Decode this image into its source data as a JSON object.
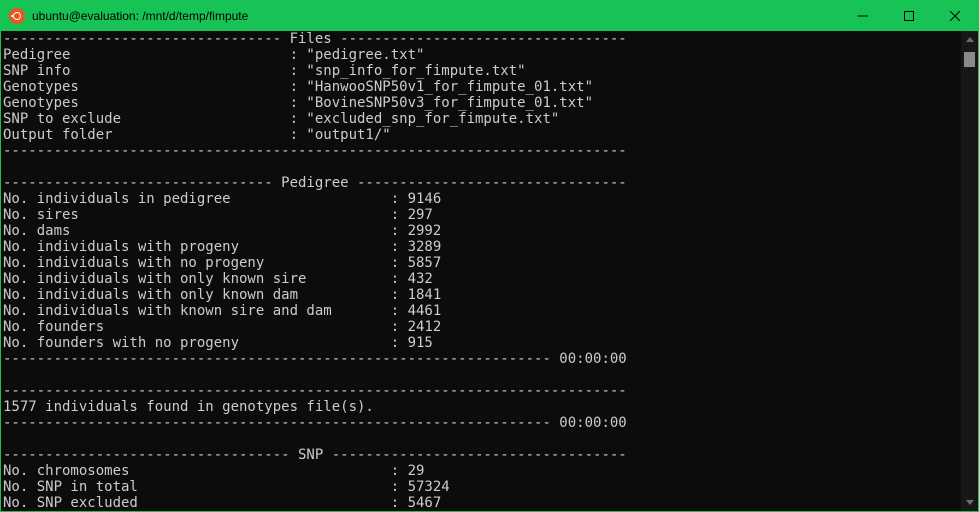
{
  "window": {
    "title": "ubuntu@evaluation: /mnt/d/temp/fimpute",
    "icon": "ubuntu-icon",
    "controls": [
      "minimize-icon",
      "maximize-icon",
      "close-icon"
    ]
  },
  "colors": {
    "titlebar": "#17c354",
    "terminal_bg": "#0c0c0c",
    "terminal_text": "#cccccc"
  },
  "terminal": {
    "lines": [
      "--------------------------------- Files ----------------------------------",
      "Pedigree                          : \"pedigree.txt\"",
      "SNP info                          : \"snp_info_for_fimpute.txt\"",
      "Genotypes                         : \"HanwooSNP50v1_for_fimpute_01.txt\"",
      "Genotypes                         : \"BovineSNP50v3_for_fimpute_01.txt\"",
      "SNP to exclude                    : \"excluded_snp_for_fimpute.txt\"",
      "Output folder                     : \"output1/\"",
      "--------------------------------------------------------------------------",
      "",
      "-------------------------------- Pedigree --------------------------------",
      "No. individuals in pedigree                   : 9146",
      "No. sires                                     : 297",
      "No. dams                                      : 2992",
      "No. individuals with progeny                  : 3289",
      "No. individuals with no progeny               : 5857",
      "No. individuals with only known sire          : 432",
      "No. individuals with only known dam           : 1841",
      "No. individuals with known sire and dam       : 4461",
      "No. founders                                  : 2412",
      "No. founders with no progeny                  : 915",
      "----------------------------------------------------------------- 00:00:00",
      "",
      "--------------------------------------------------------------------------",
      "1577 individuals found in genotypes file(s).",
      "----------------------------------------------------------------- 00:00:00",
      "",
      "---------------------------------- SNP -----------------------------------",
      "No. chromosomes                               : 29",
      "No. SNP in total                              : 57324",
      "No. SNP excluded                              : 5467"
    ]
  }
}
